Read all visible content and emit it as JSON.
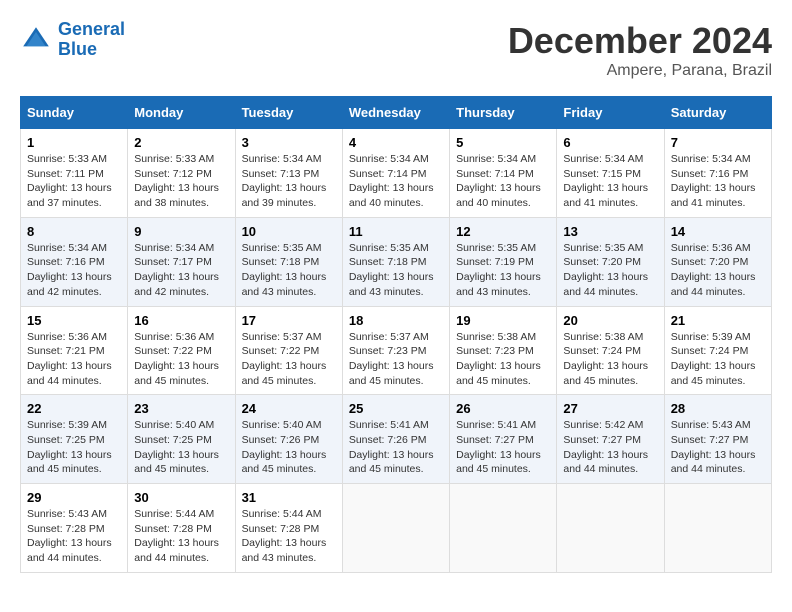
{
  "header": {
    "logo_line1": "General",
    "logo_line2": "Blue",
    "month": "December 2024",
    "location": "Ampere, Parana, Brazil"
  },
  "weekdays": [
    "Sunday",
    "Monday",
    "Tuesday",
    "Wednesday",
    "Thursday",
    "Friday",
    "Saturday"
  ],
  "weeks": [
    [
      {
        "day": "1",
        "info": "Sunrise: 5:33 AM\nSunset: 7:11 PM\nDaylight: 13 hours\nand 37 minutes."
      },
      {
        "day": "2",
        "info": "Sunrise: 5:33 AM\nSunset: 7:12 PM\nDaylight: 13 hours\nand 38 minutes."
      },
      {
        "day": "3",
        "info": "Sunrise: 5:34 AM\nSunset: 7:13 PM\nDaylight: 13 hours\nand 39 minutes."
      },
      {
        "day": "4",
        "info": "Sunrise: 5:34 AM\nSunset: 7:14 PM\nDaylight: 13 hours\nand 40 minutes."
      },
      {
        "day": "5",
        "info": "Sunrise: 5:34 AM\nSunset: 7:14 PM\nDaylight: 13 hours\nand 40 minutes."
      },
      {
        "day": "6",
        "info": "Sunrise: 5:34 AM\nSunset: 7:15 PM\nDaylight: 13 hours\nand 41 minutes."
      },
      {
        "day": "7",
        "info": "Sunrise: 5:34 AM\nSunset: 7:16 PM\nDaylight: 13 hours\nand 41 minutes."
      }
    ],
    [
      {
        "day": "8",
        "info": "Sunrise: 5:34 AM\nSunset: 7:16 PM\nDaylight: 13 hours\nand 42 minutes."
      },
      {
        "day": "9",
        "info": "Sunrise: 5:34 AM\nSunset: 7:17 PM\nDaylight: 13 hours\nand 42 minutes."
      },
      {
        "day": "10",
        "info": "Sunrise: 5:35 AM\nSunset: 7:18 PM\nDaylight: 13 hours\nand 43 minutes."
      },
      {
        "day": "11",
        "info": "Sunrise: 5:35 AM\nSunset: 7:18 PM\nDaylight: 13 hours\nand 43 minutes."
      },
      {
        "day": "12",
        "info": "Sunrise: 5:35 AM\nSunset: 7:19 PM\nDaylight: 13 hours\nand 43 minutes."
      },
      {
        "day": "13",
        "info": "Sunrise: 5:35 AM\nSunset: 7:20 PM\nDaylight: 13 hours\nand 44 minutes."
      },
      {
        "day": "14",
        "info": "Sunrise: 5:36 AM\nSunset: 7:20 PM\nDaylight: 13 hours\nand 44 minutes."
      }
    ],
    [
      {
        "day": "15",
        "info": "Sunrise: 5:36 AM\nSunset: 7:21 PM\nDaylight: 13 hours\nand 44 minutes."
      },
      {
        "day": "16",
        "info": "Sunrise: 5:36 AM\nSunset: 7:22 PM\nDaylight: 13 hours\nand 45 minutes."
      },
      {
        "day": "17",
        "info": "Sunrise: 5:37 AM\nSunset: 7:22 PM\nDaylight: 13 hours\nand 45 minutes."
      },
      {
        "day": "18",
        "info": "Sunrise: 5:37 AM\nSunset: 7:23 PM\nDaylight: 13 hours\nand 45 minutes."
      },
      {
        "day": "19",
        "info": "Sunrise: 5:38 AM\nSunset: 7:23 PM\nDaylight: 13 hours\nand 45 minutes."
      },
      {
        "day": "20",
        "info": "Sunrise: 5:38 AM\nSunset: 7:24 PM\nDaylight: 13 hours\nand 45 minutes."
      },
      {
        "day": "21",
        "info": "Sunrise: 5:39 AM\nSunset: 7:24 PM\nDaylight: 13 hours\nand 45 minutes."
      }
    ],
    [
      {
        "day": "22",
        "info": "Sunrise: 5:39 AM\nSunset: 7:25 PM\nDaylight: 13 hours\nand 45 minutes."
      },
      {
        "day": "23",
        "info": "Sunrise: 5:40 AM\nSunset: 7:25 PM\nDaylight: 13 hours\nand 45 minutes."
      },
      {
        "day": "24",
        "info": "Sunrise: 5:40 AM\nSunset: 7:26 PM\nDaylight: 13 hours\nand 45 minutes."
      },
      {
        "day": "25",
        "info": "Sunrise: 5:41 AM\nSunset: 7:26 PM\nDaylight: 13 hours\nand 45 minutes."
      },
      {
        "day": "26",
        "info": "Sunrise: 5:41 AM\nSunset: 7:27 PM\nDaylight: 13 hours\nand 45 minutes."
      },
      {
        "day": "27",
        "info": "Sunrise: 5:42 AM\nSunset: 7:27 PM\nDaylight: 13 hours\nand 44 minutes."
      },
      {
        "day": "28",
        "info": "Sunrise: 5:43 AM\nSunset: 7:27 PM\nDaylight: 13 hours\nand 44 minutes."
      }
    ],
    [
      {
        "day": "29",
        "info": "Sunrise: 5:43 AM\nSunset: 7:28 PM\nDaylight: 13 hours\nand 44 minutes."
      },
      {
        "day": "30",
        "info": "Sunrise: 5:44 AM\nSunset: 7:28 PM\nDaylight: 13 hours\nand 44 minutes."
      },
      {
        "day": "31",
        "info": "Sunrise: 5:44 AM\nSunset: 7:28 PM\nDaylight: 13 hours\nand 43 minutes."
      },
      {
        "day": "",
        "info": ""
      },
      {
        "day": "",
        "info": ""
      },
      {
        "day": "",
        "info": ""
      },
      {
        "day": "",
        "info": ""
      }
    ]
  ]
}
